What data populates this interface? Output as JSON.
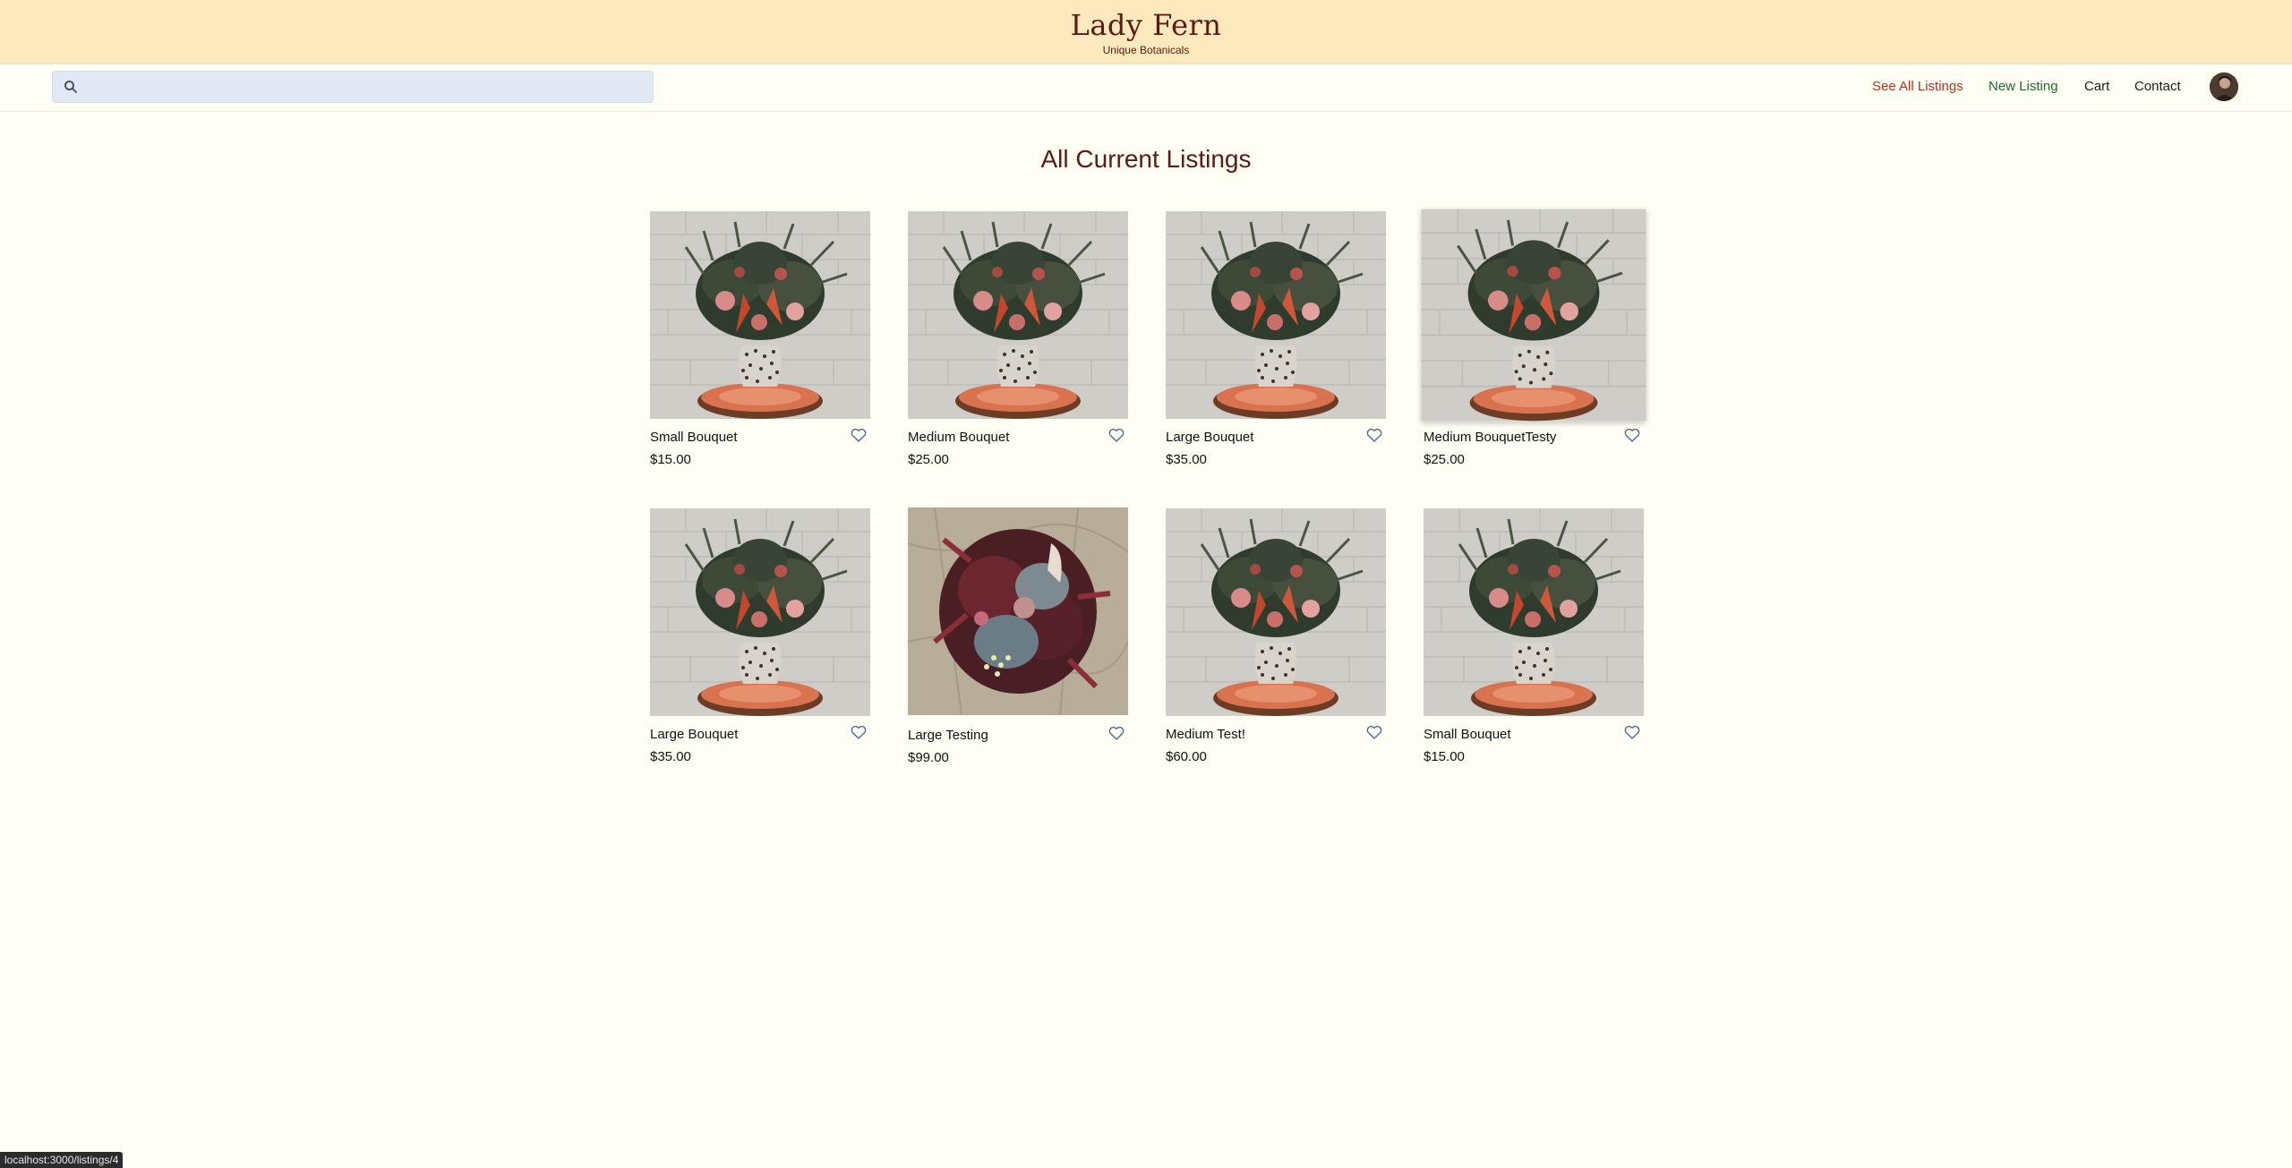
{
  "brand": {
    "title": "Lady Fern",
    "subtitle": "Unique Botanicals"
  },
  "search": {
    "placeholder": "",
    "value": ""
  },
  "nav": {
    "see_all": "See All Listings",
    "new_listing": "New Listing",
    "cart": "Cart",
    "contact": "Contact"
  },
  "colors": {
    "brand_bar": "#fde9be",
    "brand_text": "#5b1a12",
    "see_all_link": "#b5321a",
    "new_listing_link": "#1f6b2c",
    "page_background": "#fffef5"
  },
  "main": {
    "title": "All Current Listings",
    "listings": [
      {
        "name": "Small Bouquet",
        "price": "$15.00"
      },
      {
        "name": "Medium Bouquet",
        "price": "$25.00"
      },
      {
        "name": "Large Bouquet",
        "price": "$35.00"
      },
      {
        "name": "Medium BouquetTesty",
        "price": "$25.00"
      },
      {
        "name": "Large Bouquet",
        "price": "$35.00"
      },
      {
        "name": "Large Testing",
        "price": "$99.00"
      },
      {
        "name": "Medium Test!",
        "price": "$60.00"
      },
      {
        "name": "Small Bouquet",
        "price": "$15.00"
      }
    ]
  },
  "status_bar": {
    "url": "localhost:3000/listings/4"
  },
  "icons": {
    "search": "search-icon",
    "favorite": "heart-icon",
    "avatar": "user-avatar"
  }
}
